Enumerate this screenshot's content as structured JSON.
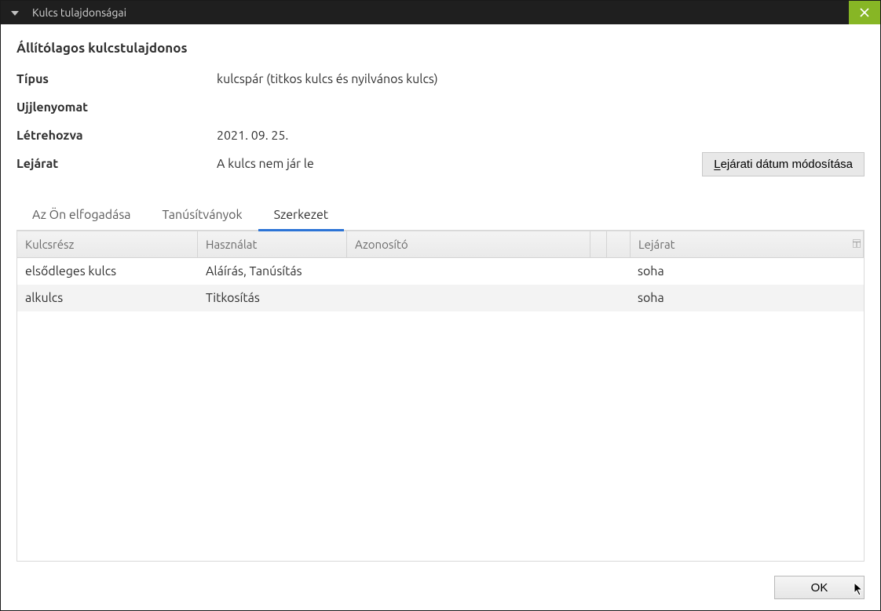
{
  "window": {
    "title": "Kulcs tulajdonságai"
  },
  "heading": "Állítólagos kulcstulajdonos",
  "fields": {
    "type_label": "Típus",
    "type_value": "kulcspár (titkos kulcs és nyilvános kulcs)",
    "fingerprint_label": "Ujjlenyomat",
    "fingerprint_value": "",
    "created_label": "Létrehozva",
    "created_value": "2021. 09. 25.",
    "expiry_label": "Lejárat",
    "expiry_value": "A kulcs nem jár le",
    "expiry_button_prefix": "L",
    "expiry_button_rest": "ejárati dátum módosítása"
  },
  "tabs": {
    "accept": "Az Ön elfogadása",
    "certs": "Tanúsítványok",
    "struct": "Szerkezet"
  },
  "table": {
    "headers": {
      "part": "Kulcsrész",
      "usage": "Használat",
      "id": "Azonosító",
      "expiry": "Lejárat"
    },
    "rows": [
      {
        "part": "elsődleges kulcs",
        "usage": "Aláírás, Tanúsítás",
        "id": "",
        "expiry": "soha"
      },
      {
        "part": "alkulcs",
        "usage": "Titkosítás",
        "id": "",
        "expiry": "soha"
      }
    ]
  },
  "footer": {
    "ok": "OK"
  }
}
